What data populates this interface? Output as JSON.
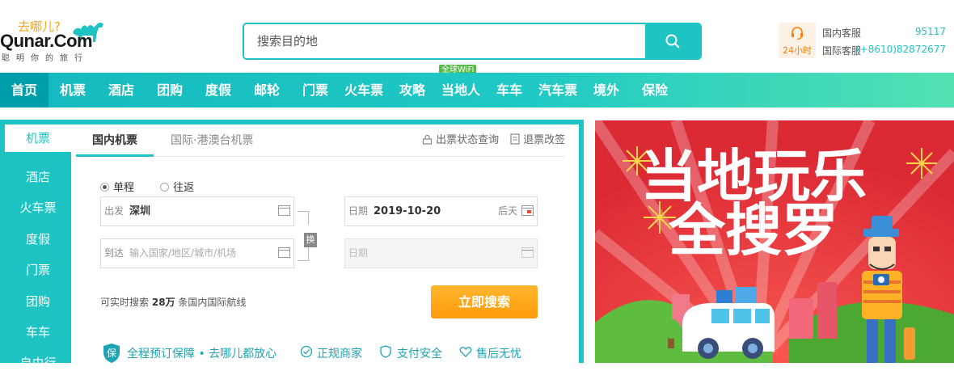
{
  "header": {
    "logo_cn": "去哪儿?",
    "logo_en": "Qunar.Com",
    "slogan": "聪明你的旅行",
    "search_placeholder": "搜索目的地",
    "wifi_badge": "全球WiFi",
    "service_hours": "24小时",
    "service_domestic_label": "国内客服",
    "service_domestic_number": "95117",
    "service_intl_label": "国际客服",
    "service_intl_number": "(+8610)82872677"
  },
  "nav": {
    "items": [
      "首页",
      "机票",
      "酒店",
      "团购",
      "度假",
      "邮轮",
      "门票",
      "火车票",
      "攻略",
      "当地人",
      "车车",
      "汽车票",
      "境外",
      "保险"
    ],
    "active_index": 0
  },
  "sidebar": {
    "items": [
      "机票",
      "酒店",
      "火车票",
      "度假",
      "门票",
      "团购",
      "车车",
      "自由行"
    ],
    "active_index": 0
  },
  "booking": {
    "tabs": [
      "国内机票",
      "国际·港澳台机票"
    ],
    "links": [
      "出票状态查询",
      "退票改签"
    ],
    "trip_types": [
      "单程",
      "往返"
    ],
    "selected_trip": "单程",
    "depart_label": "出发",
    "depart_value": "深圳",
    "arrive_label": "到达",
    "arrive_placeholder": "输入国家/地区/城市/机场",
    "swap_label": "换",
    "date_label": "日期",
    "date_value": "2019-10-20",
    "date_hint": "后天",
    "return_date_label": "日期",
    "route_count_prefix": "可实时搜索",
    "route_count_value": "28万",
    "route_count_suffix": "条国内国际航线",
    "search_button": "立即搜索",
    "guarantees": [
      "全程预订保障 • 去哪儿都放心",
      "正规商家",
      "支付安全",
      "售后无忧"
    ]
  },
  "banner": {
    "line1": "当地玩乐",
    "line2": "全搜罗"
  },
  "colors": {
    "brand": "#1ec3c3",
    "orange": "#ff9b0a",
    "banner_red": "#e8333f"
  }
}
